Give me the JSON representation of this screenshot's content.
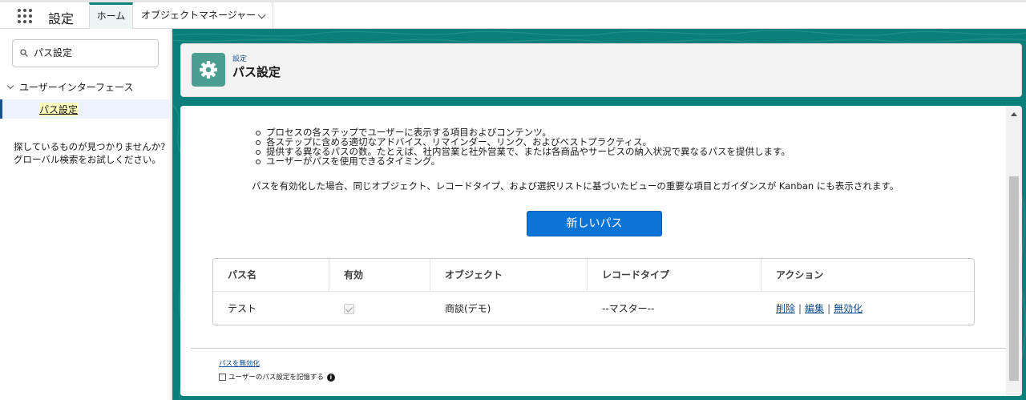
{
  "top_nav": {
    "app_name": "設定",
    "tabs": [
      {
        "label": "ホーム",
        "active": true
      },
      {
        "label": "オブジェクトマネージャー",
        "active": false
      }
    ]
  },
  "sidebar": {
    "search_value": "パス設定",
    "tree_parent": "ユーザーインターフェース",
    "tree_child": "パス設定",
    "not_found_line1": "探しているものが見つかりませんか?",
    "not_found_line2": "グローバル検索をお試しください。"
  },
  "header": {
    "breadcrumb": "設定",
    "title": "パス設定",
    "icon": "gear-icon"
  },
  "content": {
    "bullets": [
      "プロセスの各ステップでユーザーに表示する項目およびコンテンツ。",
      "各ステップに含める適切なアドバイス、リマインダー、リンク、およびベストプラクティス。",
      "提供する異なるパスの数。たとえば、社内営業と社外営業で、または各商品やサービスの納入状況で異なるパスを提供します。",
      "ユーザーがパスを使用できるタイミング。"
    ],
    "description": "パスを有効化した場合、同じオブジェクト、レコードタイプ、および選択リストに基づいたビューの重要な項目とガイダンスが Kanban にも表示されます。",
    "new_path_button": "新しいパス"
  },
  "table": {
    "headers": [
      "パス名",
      "有効",
      "オブジェクト",
      "レコードタイプ",
      "アクション"
    ],
    "rows": [
      {
        "name": "テスト",
        "active": true,
        "object": "商談(デモ)",
        "record_type": "--マスター--",
        "actions": [
          "削除",
          "編集",
          "無効化"
        ]
      }
    ]
  },
  "footer": {
    "disable_link": "パスを無効化",
    "remember_label": "ユーザーのパス設定を記憶する"
  },
  "colors": {
    "brand_teal": "#0b7f7a",
    "button_blue": "#0b74d6",
    "link_blue": "#0b4a8a"
  }
}
